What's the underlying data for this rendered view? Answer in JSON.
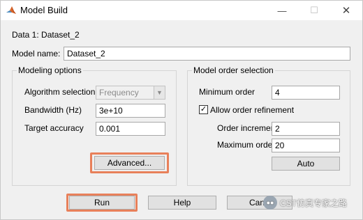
{
  "window": {
    "title": "Model Build",
    "minimize_glyph": "—",
    "maximize_glyph": "☐",
    "close_glyph": "✕"
  },
  "data_label": "Data 1: Dataset_2",
  "model_name": {
    "label": "Model name:",
    "value": "Dataset_2"
  },
  "modeling_options": {
    "title": "Modeling options",
    "algorithm": {
      "label": "Algorithm selection",
      "value": "Frequency"
    },
    "bandwidth": {
      "label": "Bandwidth (Hz)",
      "value": "3e+10"
    },
    "accuracy": {
      "label": "Target accuracy",
      "value": "0.001"
    },
    "advanced_button": "Advanced..."
  },
  "model_order": {
    "title": "Model order selection",
    "minimum": {
      "label": "Minimum order",
      "value": "4"
    },
    "allow_refinement": {
      "label": "Allow order refinement",
      "checked": true,
      "check_glyph": "✓"
    },
    "increment": {
      "label": "Order increment",
      "value": "2"
    },
    "maximum": {
      "label": "Maximum order",
      "value": "20"
    },
    "auto_button": "Auto"
  },
  "buttons": {
    "run": "Run",
    "help": "Help",
    "cancel": "Canc"
  },
  "watermark": "CST仿真专家之路",
  "colors": {
    "highlight": "#e8805a",
    "title_bar": "#ffffff",
    "client_bg": "#f0f0f0"
  }
}
